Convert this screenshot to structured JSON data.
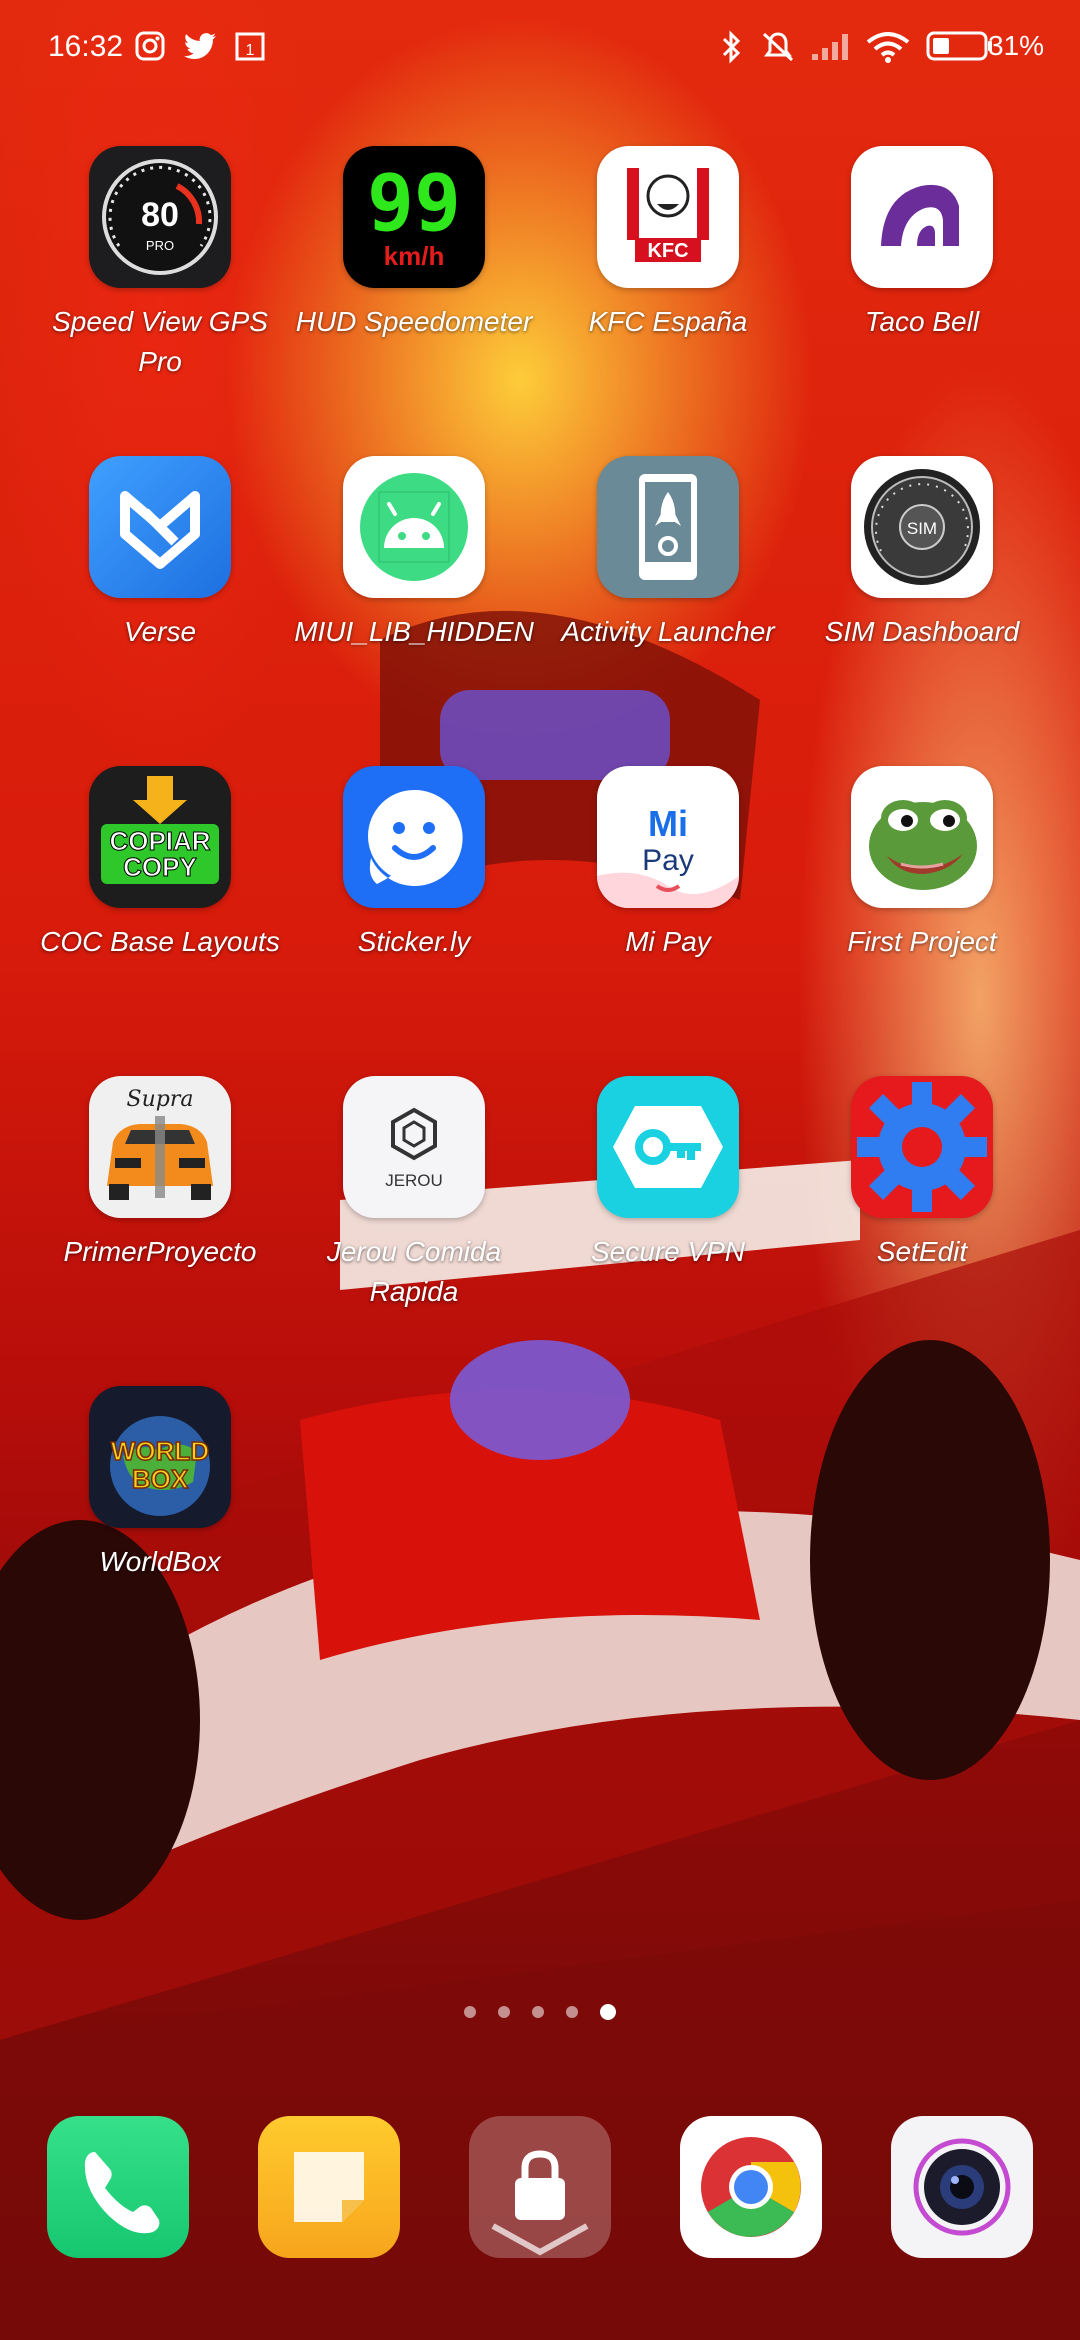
{
  "status_bar": {
    "time": "16:32",
    "battery_percent": "31%",
    "left_icons": [
      "instagram-icon",
      "twitter-icon",
      "calendar-icon"
    ],
    "right_icons": [
      "bluetooth-icon",
      "ringer-muted-icon",
      "signal-icon",
      "wifi-icon",
      "battery-icon"
    ]
  },
  "apps": [
    {
      "label": "Speed View GPS Pro",
      "icon": "speedometer-icon"
    },
    {
      "label": "HUD Speedometer",
      "icon": "hud-speed-icon"
    },
    {
      "label": "KFC España",
      "icon": "kfc-icon"
    },
    {
      "label": "Taco Bell",
      "icon": "taco-bell-icon"
    },
    {
      "label": "Verse",
      "icon": "verse-icon"
    },
    {
      "label": "MIUI_LIB_HIDDEN",
      "icon": "android-icon"
    },
    {
      "label": "Activity Launcher",
      "icon": "activity-launcher-icon"
    },
    {
      "label": "SIM Dashboard",
      "icon": "sim-gauge-icon"
    },
    {
      "label": "COC Base Layouts",
      "icon": "copy-icon"
    },
    {
      "label": "Sticker.ly",
      "icon": "smiley-icon"
    },
    {
      "label": "Mi Pay",
      "icon": "mi-pay-icon"
    },
    {
      "label": "First Project",
      "icon": "frog-icon"
    },
    {
      "label": "PrimerProyecto",
      "icon": "supra-car-icon"
    },
    {
      "label": "Jerou Comida Rapida",
      "icon": "jerou-icon"
    },
    {
      "label": "Secure VPN",
      "icon": "key-icon"
    },
    {
      "label": "SetEdit",
      "icon": "gear-icon"
    },
    {
      "label": "WorldBox",
      "icon": "worldbox-icon"
    }
  ],
  "icon_text": {
    "speed_value": "80",
    "speed_sub": "PRO",
    "hud_value": "99",
    "hud_unit": "km/h",
    "kfc": "KFC",
    "sim": "SIM",
    "copiar": "COPIAR",
    "copy": "COPY",
    "mi": "Mi",
    "pay": "Pay",
    "jerou": "JEROU",
    "supra": "Supra",
    "world": "WORLD",
    "box": "BOX"
  },
  "page_indicator": {
    "count": 5,
    "active": 5
  },
  "dock": [
    {
      "icon": "phone-icon"
    },
    {
      "icon": "notes-icon"
    },
    {
      "icon": "lock-icon"
    },
    {
      "icon": "chrome-icon"
    },
    {
      "icon": "camera-icon"
    }
  ]
}
